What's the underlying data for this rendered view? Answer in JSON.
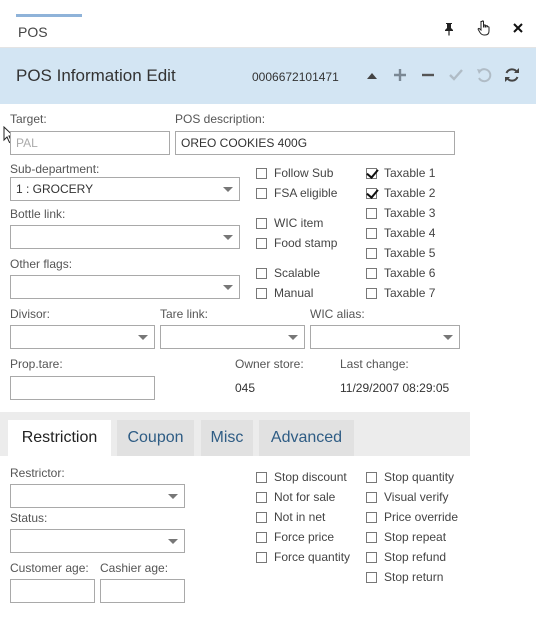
{
  "window": {
    "tab_label": "POS",
    "icons": [
      "pin-icon",
      "pointer-icon",
      "close-icon"
    ]
  },
  "header": {
    "title": "POS Information Edit",
    "record_code": "0006672101471",
    "toolbar_icons": [
      "arrow-up-icon",
      "plus-icon",
      "minus-icon",
      "check-icon",
      "undo-icon",
      "refresh-icon"
    ]
  },
  "form": {
    "target": {
      "label": "Target:",
      "placeholder": "PAL"
    },
    "pos_description": {
      "label": "POS description:",
      "value": "OREO COOKIES 400G"
    },
    "sub_department": {
      "label": "Sub-department:",
      "value": "1 : GROCERY"
    },
    "bottle_link": {
      "label": "Bottle link:",
      "value": ""
    },
    "other_flags": {
      "label": "Other flags:",
      "value": ""
    },
    "divisor": {
      "label": "Divisor:",
      "value": ""
    },
    "tare_link": {
      "label": "Tare link:",
      "value": ""
    },
    "wic_alias": {
      "label": "WIC alias:",
      "value": ""
    },
    "prop_tare": {
      "label": "Prop.tare:",
      "value": ""
    },
    "owner_store": {
      "label": "Owner store:",
      "value": "045"
    },
    "last_change": {
      "label": "Last change:",
      "value": "11/29/2007 08:29:05"
    },
    "flags": [
      {
        "label": "Follow Sub",
        "checked": false
      },
      {
        "label": "FSA eligible",
        "checked": false
      },
      {
        "label": "WIC item",
        "checked": false
      },
      {
        "label": "Food stamp",
        "checked": false
      },
      {
        "label": "Scalable",
        "checked": false
      },
      {
        "label": "Manual",
        "checked": false
      }
    ],
    "taxables": [
      {
        "label": "Taxable 1",
        "checked": true
      },
      {
        "label": "Taxable 2",
        "checked": true
      },
      {
        "label": "Taxable 3",
        "checked": false
      },
      {
        "label": "Taxable 4",
        "checked": false
      },
      {
        "label": "Taxable 5",
        "checked": false
      },
      {
        "label": "Taxable 6",
        "checked": false
      },
      {
        "label": "Taxable 7",
        "checked": false
      }
    ]
  },
  "tabs": [
    {
      "label": "Restriction",
      "active": true
    },
    {
      "label": "Coupon",
      "active": false
    },
    {
      "label": "Misc",
      "active": false
    },
    {
      "label": "Advanced",
      "active": false
    }
  ],
  "restriction": {
    "restrictor": {
      "label": "Restrictor:",
      "value": ""
    },
    "status": {
      "label": "Status:",
      "value": ""
    },
    "customer_age": {
      "label": "Customer age:",
      "value": ""
    },
    "cashier_age": {
      "label": "Cashier age:",
      "value": ""
    },
    "checks_left": [
      {
        "label": "Stop discount",
        "checked": false
      },
      {
        "label": "Not for sale",
        "checked": false
      },
      {
        "label": "Not in net",
        "checked": false
      },
      {
        "label": "Force price",
        "checked": false
      },
      {
        "label": "Force quantity",
        "checked": false
      }
    ],
    "checks_right": [
      {
        "label": "Stop quantity",
        "checked": false
      },
      {
        "label": "Visual verify",
        "checked": false
      },
      {
        "label": "Price override",
        "checked": false
      },
      {
        "label": "Stop repeat",
        "checked": false
      },
      {
        "label": "Stop refund",
        "checked": false
      },
      {
        "label": "Stop return",
        "checked": false
      }
    ]
  },
  "colors": {
    "header_bg": "#d3e5f3",
    "tab_accent": "#8fb3d9",
    "tab_text": "#2e5c84"
  }
}
